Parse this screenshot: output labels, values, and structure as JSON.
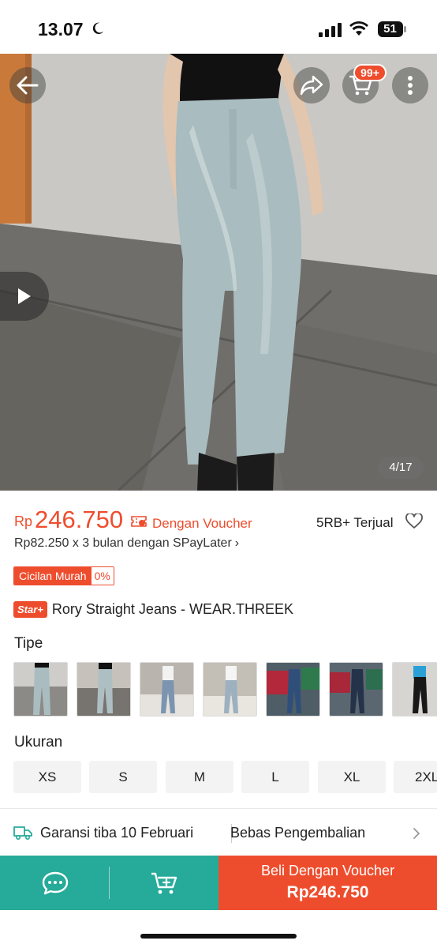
{
  "status_bar": {
    "time": "13.07",
    "battery": "51"
  },
  "hero": {
    "cart_badge": "99+",
    "image_counter": "4/17"
  },
  "price": {
    "currency": "Rp",
    "value": "246.750",
    "voucher_text": "Dengan Voucher",
    "sold": "5RB+ Terjual",
    "paylater": "Rp82.250 x 3 bulan dengan SPayLater"
  },
  "cicilan": {
    "label": "Cicilan Murah",
    "percent": "0%"
  },
  "product": {
    "badge": "Star+",
    "title": "Rory Straight Jeans - WEAR.THREEK"
  },
  "tipe": {
    "label": "Tipe",
    "variant_count_shown": 7
  },
  "ukuran": {
    "label": "Ukuran",
    "sizes": [
      "XS",
      "S",
      "M",
      "L",
      "XL",
      "2XL"
    ]
  },
  "shipping": {
    "guarantee": "Garansi tiba 10 Februari",
    "returns": "Bebas Pengembalian"
  },
  "bottom_bar": {
    "buy_label": "Beli Dengan Voucher",
    "buy_price": "Rp246.750"
  },
  "colors": {
    "accent": "#ee4d2d",
    "teal": "#26aa99"
  }
}
